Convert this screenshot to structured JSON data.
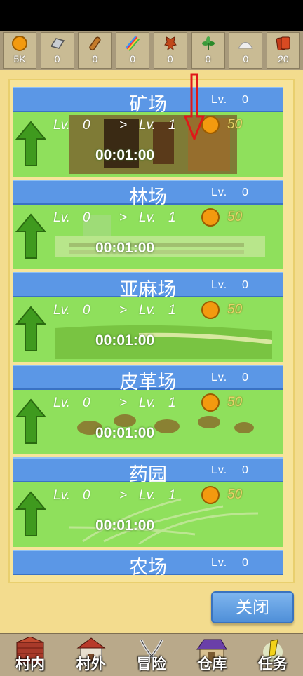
{
  "resources": [
    {
      "icon": "gold-coin-icon",
      "value": "5K"
    },
    {
      "icon": "iron-ingot-icon",
      "value": "0"
    },
    {
      "icon": "wood-log-icon",
      "value": "0"
    },
    {
      "icon": "linen-roll-icon",
      "value": "0"
    },
    {
      "icon": "leather-hide-icon",
      "value": "0"
    },
    {
      "icon": "herb-icon",
      "value": "0"
    },
    {
      "icon": "salt-pile-icon",
      "value": "0"
    },
    {
      "icon": "cards-icon",
      "value": "20"
    }
  ],
  "buildings": [
    {
      "name": "矿场",
      "lv_label": "Lv.",
      "level": "0",
      "from_label": "Lv.",
      "from": "0",
      "arrow": ">",
      "to_label": "Lv.",
      "to": "1",
      "cost": "50",
      "time": "00:01:00"
    },
    {
      "name": "林场",
      "lv_label": "Lv.",
      "level": "0",
      "from_label": "Lv.",
      "from": "0",
      "arrow": ">",
      "to_label": "Lv.",
      "to": "1",
      "cost": "50",
      "time": "00:01:00"
    },
    {
      "name": "亚麻场",
      "lv_label": "Lv.",
      "level": "0",
      "from_label": "Lv.",
      "from": "0",
      "arrow": ">",
      "to_label": "Lv.",
      "to": "1",
      "cost": "50",
      "time": "00:01:00"
    },
    {
      "name": "皮革场",
      "lv_label": "Lv.",
      "level": "0",
      "from_label": "Lv.",
      "from": "0",
      "arrow": ">",
      "to_label": "Lv.",
      "to": "1",
      "cost": "50",
      "time": "00:01:00"
    },
    {
      "name": "药园",
      "lv_label": "Lv.",
      "level": "0",
      "from_label": "Lv.",
      "from": "0",
      "arrow": ">",
      "to_label": "Lv.",
      "to": "1",
      "cost": "50",
      "time": "00:01:00"
    },
    {
      "name": "农场",
      "lv_label": "Lv.",
      "level": "0"
    }
  ],
  "close_label": "关闭",
  "nav": [
    {
      "label": "村内",
      "icon": "village-inside-icon"
    },
    {
      "label": "村外",
      "icon": "village-outside-icon"
    },
    {
      "label": "冒险",
      "icon": "crossed-swords-icon"
    },
    {
      "label": "仓库",
      "icon": "warehouse-icon"
    },
    {
      "label": "任务",
      "icon": "quest-scroll-icon"
    }
  ],
  "colors": {
    "header_blue": "#5b97e6",
    "row_green": "#8fe05c",
    "panel_yellow": "#f7e49a",
    "coin": "#f39a0f"
  }
}
